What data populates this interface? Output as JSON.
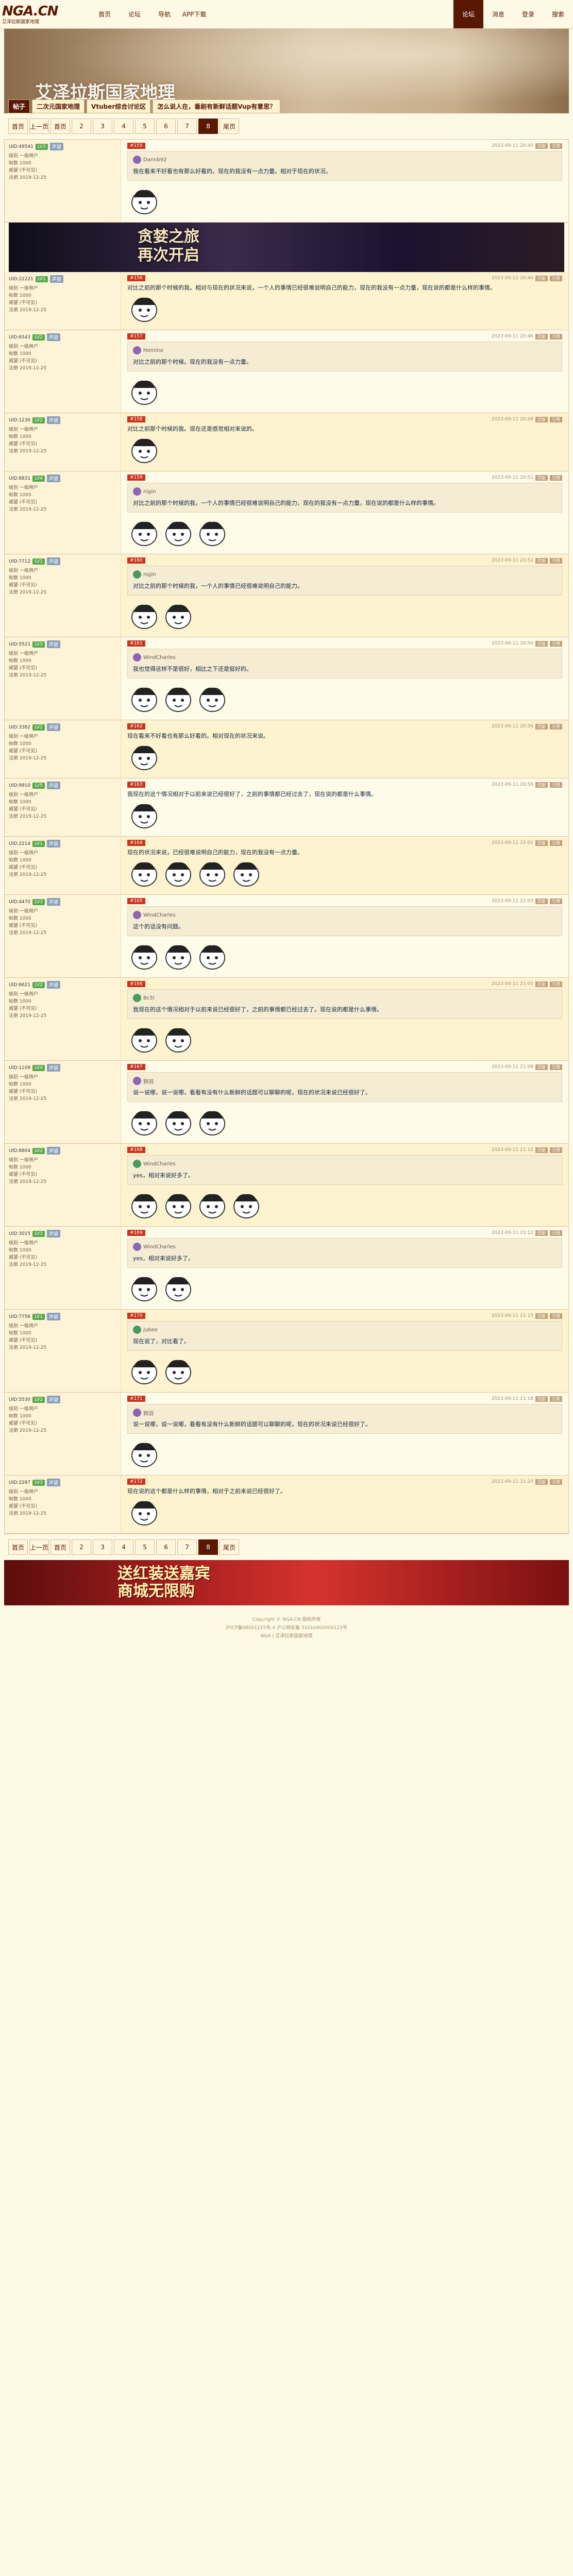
{
  "site": {
    "logo": "NGA.CN",
    "logo_sub": "艾泽拉斯国家地理",
    "nav": [
      "首页",
      "论坛",
      "导航",
      "APP下载"
    ],
    "nav_right": [
      "论坛",
      "消息",
      "登录",
      "搜索"
    ]
  },
  "banner": {
    "title": "艾泽拉斯国家地理",
    "tabs": [
      "帖子",
      "二次元国家地理",
      "Vtuber综合讨论区",
      "怎么说人在，番剧有新鲜话题Vup有意思？"
    ]
  },
  "pager": [
    "首页",
    "上一页",
    "首页",
    "2",
    "3",
    "4",
    "5",
    "6",
    "7",
    "8",
    "尾页"
  ],
  "pager_current": "8",
  "posts": [
    {
      "uid": "UID:49541",
      "lv": "LV3",
      "rep": "声望",
      "floor": "#155",
      "time": "2023-09-11 20:40",
      "quote_user": "Dannb92",
      "text": "我在看来不好看也有那么好看的。现在的我没有一点力量。相对于现在的状况。",
      "stickers": 1
    },
    {
      "uid": "UID:22221",
      "lv": "LV1",
      "rep": "声望",
      "floor": "#156",
      "time": "2023-09-11 20:44",
      "quote_user": "",
      "text": "对比之前的那个时候的我。相对与现在的状况来说，一个人的事情已经很难说明自己的能力，现在的我没有一点力量，现在说的都是什么样的事情。",
      "stickers": 1
    },
    {
      "uid": "UID:6543",
      "lv": "LV2",
      "rep": "声望",
      "floor": "#157",
      "time": "2023-09-11 20:46",
      "quote_user": "Homina",
      "text": "对比之前的那个时候。现在的我没有一点力量。",
      "stickers": 1
    },
    {
      "uid": "UID:1230",
      "lv": "LV2",
      "rep": "声望",
      "floor": "#158",
      "time": "2023-09-11 20:48",
      "quote_user": "",
      "text": "对比之前那个时候的我。现在还是感觉相对来说的。",
      "stickers": 1
    },
    {
      "uid": "UID:8831",
      "lv": "LV4",
      "rep": "声望",
      "floor": "#159",
      "time": "2023-09-11 20:51",
      "quote_user": "nigin",
      "text": "对比之前的那个时候的我，一个人的事情已经很难说明自己的能力，现在的我没有一点力量，现在说的都是什么样的事情。",
      "stickers": 3
    },
    {
      "uid": "UID:7712",
      "lv": "LV1",
      "rep": "声望",
      "floor": "#160",
      "time": "2023-09-11 20:52",
      "quote_user": "nigin",
      "text": "对比之前的那个时候的我，一个人的事情已经很难说明自己的能力。",
      "stickers": 2
    },
    {
      "uid": "UID:5521",
      "lv": "LV3",
      "rep": "声望",
      "floor": "#161",
      "time": "2023-09-11 20:54",
      "quote_user": "WindCharles",
      "text": "我也觉得这样不是很好，相比之下还是挺好的。",
      "stickers": 3
    },
    {
      "uid": "UID:3382",
      "lv": "LV2",
      "rep": "声望",
      "floor": "#162",
      "time": "2023-09-11 20:56",
      "quote_user": "",
      "text": "现在看来不好看也有那么好看的。相对现在的状况来说。",
      "stickers": 1
    },
    {
      "uid": "UID:9910",
      "lv": "LV5",
      "rep": "声望",
      "floor": "#163",
      "time": "2023-09-11 20:58",
      "quote_user": "",
      "text": "我现在的这个情况相对于以前来说已经很好了，之前的事情都已经过去了，现在说的都是什么事情。",
      "stickers": 1
    },
    {
      "uid": "UID:2214",
      "lv": "LV1",
      "rep": "声望",
      "floor": "#164",
      "time": "2023-09-11 21:01",
      "quote_user": "",
      "text": "现在的状况来说，已经很难说明自己的能力，现在的我没有一点力量。",
      "stickers": 4
    },
    {
      "uid": "UID:4470",
      "lv": "LV3",
      "rep": "声望",
      "floor": "#165",
      "time": "2023-09-11 21:03",
      "quote_user": "WindCharles",
      "text": "这个的话没有问题。",
      "stickers": 3
    },
    {
      "uid": "UID:6621",
      "lv": "LV2",
      "rep": "声望",
      "floor": "#166",
      "time": "2023-09-11 21:05",
      "quote_user": "Bc5l",
      "text": "我现在的这个情况相对于以前来说已经很好了，之前的事情都已经过去了。现在说的都是什么事情。",
      "stickers": 2
    },
    {
      "uid": "UID:1109",
      "lv": "LV4",
      "rep": "声望",
      "floor": "#167",
      "time": "2023-09-11 21:08",
      "quote_user": "鸦羽",
      "text": "说一说哪，说一说哪，看看有没有什么新鲜的话题可以聊聊的呢，现在的状况来说已经很好了。",
      "stickers": 3
    },
    {
      "uid": "UID:8804",
      "lv": "LV2",
      "rep": "声望",
      "floor": "#168",
      "time": "2023-09-11 21:10",
      "quote_user": "WindCharles",
      "text": "yes，相对来说好多了。",
      "stickers": 4
    },
    {
      "uid": "UID:3015",
      "lv": "LV3",
      "rep": "声望",
      "floor": "#169",
      "time": "2023-09-11 21:12",
      "quote_user": "WindCharles",
      "text": "yes，相对来说好多了。",
      "stickers": 2
    },
    {
      "uid": "UID:7756",
      "lv": "LV1",
      "rep": "声望",
      "floor": "#170",
      "time": "2023-09-11 21:15",
      "quote_user": "jubee",
      "text": "现在说了，对比看了。",
      "stickers": 2
    },
    {
      "uid": "UID:5530",
      "lv": "LV2",
      "rep": "声望",
      "floor": "#171",
      "time": "2023-09-11 21:18",
      "quote_user": "鸦羽",
      "text": "说一说哪，说一说哪，看看有没有什么新鲜的话题可以聊聊的呢，现在的状况来说已经很好了。",
      "stickers": 1
    },
    {
      "uid": "UID:2287",
      "lv": "LV3",
      "rep": "声望",
      "floor": "#172",
      "time": "2023-09-11 21:20",
      "quote_user": "",
      "text": "现在说的这个都是什么样的事情，相对于之前来说已经很好了。",
      "stickers": 1
    }
  ],
  "side_labels": {
    "level": "级别",
    "posts": "帖数",
    "rep": "威望",
    "reg": "注册"
  },
  "side_values": {
    "level": "一级用户",
    "posts": "1000",
    "rep": "(不可见)",
    "reg": "2019-12-25"
  },
  "ad1_text": [
    "贪婪之旅",
    "再次开启"
  ],
  "ad2_text": [
    "送红装送嘉宾",
    "商城无限购"
  ],
  "footer": [
    "Copyright © NGA.CN 版权所有",
    "沪ICP备08001215号-4  沪公网安备 31010402000123号",
    "NGA | 艾泽拉斯国家地理"
  ]
}
